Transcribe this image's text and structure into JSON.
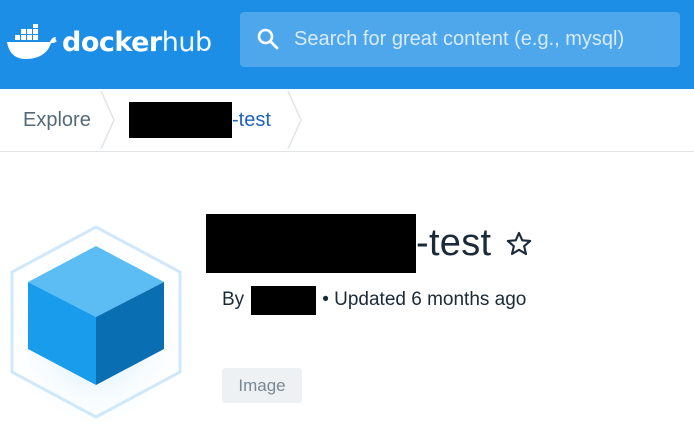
{
  "header": {
    "logo_text_bold": "docker",
    "logo_text_light": "hub",
    "search_placeholder": "Search for great content (e.g., mysql)",
    "search_icon": "search-icon"
  },
  "breadcrumb": {
    "items": [
      {
        "label": "Explore"
      },
      {
        "label": "-test"
      }
    ]
  },
  "repo": {
    "name_suffix": "-test",
    "by_label": "By",
    "updated_text": "• Updated 6 months ago",
    "tag_label": "Image",
    "star_icon": "star-outline-icon"
  },
  "colors": {
    "header_bg": "#1d8ee6",
    "link_blue": "#1d63b8",
    "text_dark": "#1a2a38"
  }
}
